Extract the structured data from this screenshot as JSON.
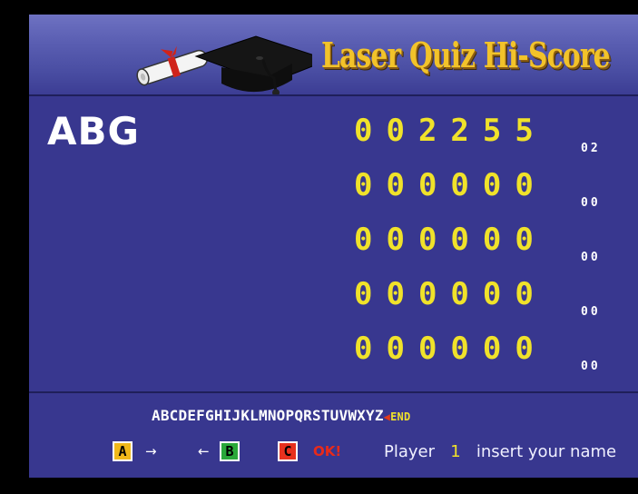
{
  "header": {
    "title": "Laser Quiz Hi-Score"
  },
  "current_player": {
    "name": "ABG"
  },
  "scores": [
    {
      "digits": "002255",
      "suffix": "02"
    },
    {
      "digits": "000000",
      "suffix": "00"
    },
    {
      "digits": "000000",
      "suffix": "00"
    },
    {
      "digits": "000000",
      "suffix": "00"
    },
    {
      "digits": "000000",
      "suffix": "00"
    }
  ],
  "entry": {
    "alphabet": "ABCDEFGHIJKLMNOPQRSTUVWXYZ",
    "end_label": "END",
    "end_arrow": "◀"
  },
  "controls": {
    "a_label": "A",
    "a_arrow": "→",
    "b_arrow": "←",
    "b_label": "B",
    "c_label": "C",
    "ok_label": "OK!",
    "colors": {
      "a": "#f0b81a",
      "b": "#2aa83a",
      "c": "#e8311e"
    }
  },
  "prompt": {
    "pre": "Player",
    "number": "1",
    "post": "insert your name"
  }
}
